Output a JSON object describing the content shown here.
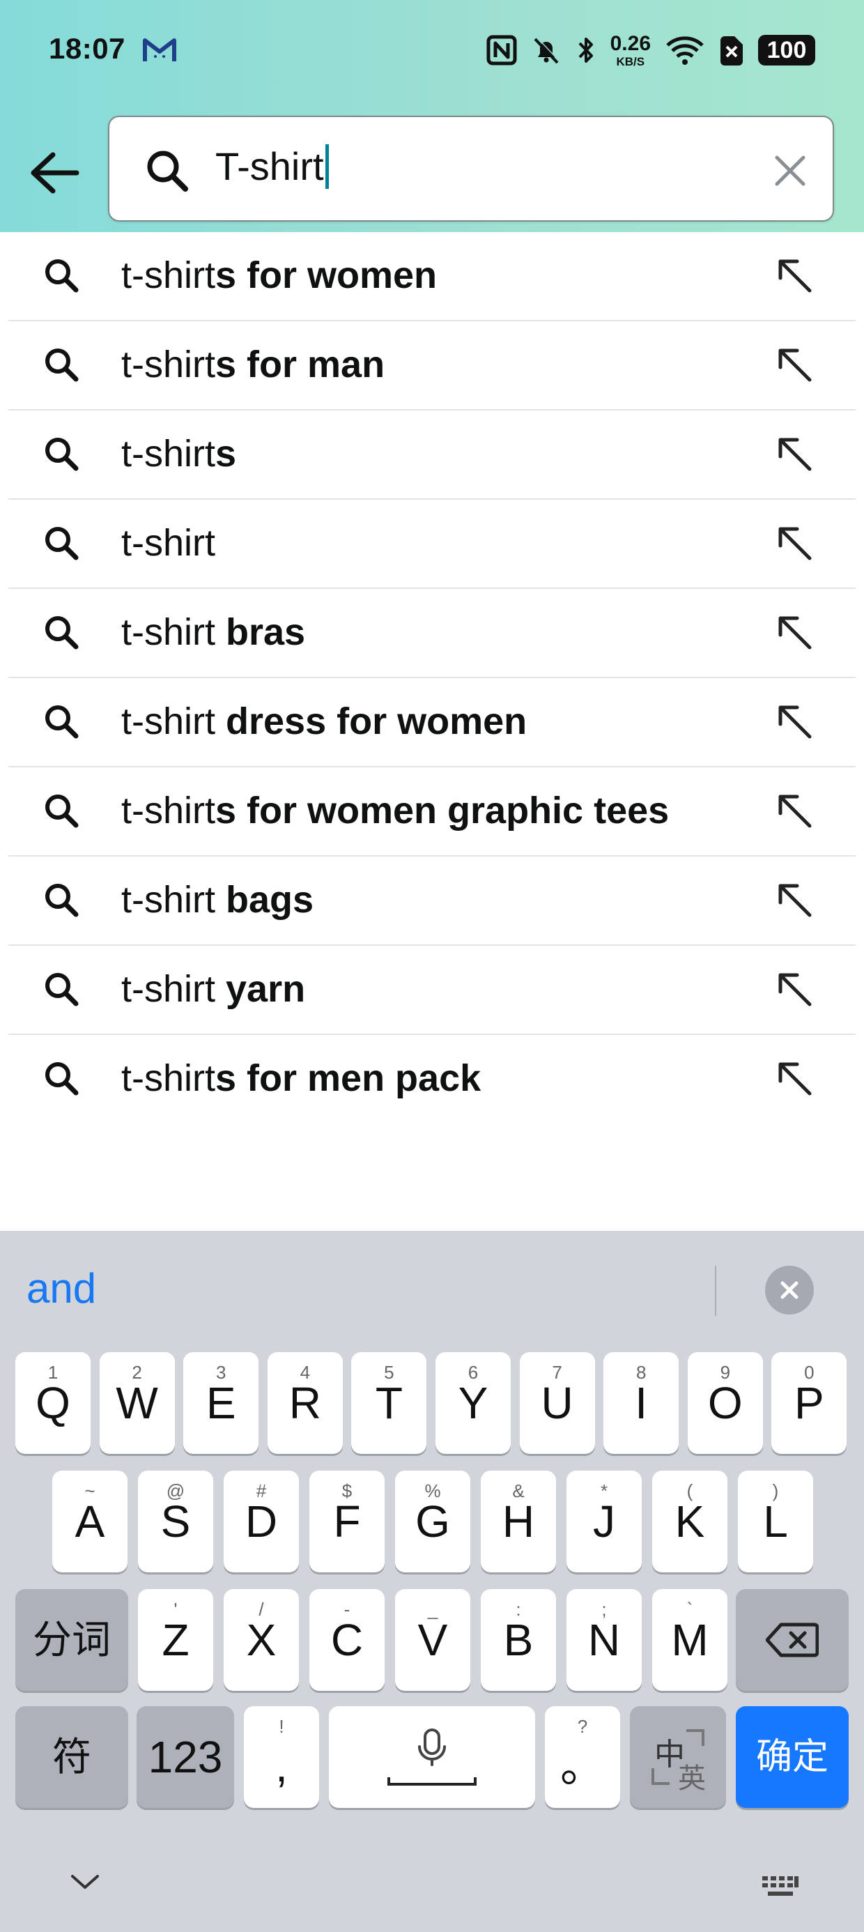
{
  "status_bar": {
    "time": "18:07",
    "network_speed_value": "0.26",
    "network_speed_unit": "KB/S",
    "battery": "100",
    "icons": [
      "gmail-icon",
      "nfc-icon",
      "bell-muted-icon",
      "bluetooth-icon",
      "wifi-icon",
      "sim-off-icon"
    ]
  },
  "search": {
    "query": "T-shirt",
    "icon": "search-icon",
    "clear_icon": "close-icon",
    "back_icon": "back-arrow-icon"
  },
  "suggestions": [
    {
      "prefix": "t-shirt",
      "bold": "s for women"
    },
    {
      "prefix": "t-shirt",
      "bold": "s for man"
    },
    {
      "prefix": "t-shirt",
      "bold": "s"
    },
    {
      "prefix": "t-shirt",
      "bold": ""
    },
    {
      "prefix": "t-shirt ",
      "bold": "bras"
    },
    {
      "prefix": "t-shirt ",
      "bold": "dress for women"
    },
    {
      "prefix": "t-shirt",
      "bold": "s for women graphic tees"
    },
    {
      "prefix": "t-shirt ",
      "bold": "bags"
    },
    {
      "prefix": "t-shirt ",
      "bold": "yarn"
    },
    {
      "prefix": "t-shirt",
      "bold": "s for men pack"
    }
  ],
  "keyboard": {
    "candidate": "and",
    "row1": [
      {
        "main": "Q",
        "sub": "1"
      },
      {
        "main": "W",
        "sub": "2"
      },
      {
        "main": "E",
        "sub": "3"
      },
      {
        "main": "R",
        "sub": "4"
      },
      {
        "main": "T",
        "sub": "5"
      },
      {
        "main": "Y",
        "sub": "6"
      },
      {
        "main": "U",
        "sub": "7"
      },
      {
        "main": "I",
        "sub": "8"
      },
      {
        "main": "O",
        "sub": "9"
      },
      {
        "main": "P",
        "sub": "0"
      }
    ],
    "row2": [
      {
        "main": "A",
        "sub": "~"
      },
      {
        "main": "S",
        "sub": "@"
      },
      {
        "main": "D",
        "sub": "#"
      },
      {
        "main": "F",
        "sub": "$"
      },
      {
        "main": "G",
        "sub": "%"
      },
      {
        "main": "H",
        "sub": "&"
      },
      {
        "main": "J",
        "sub": "*"
      },
      {
        "main": "K",
        "sub": "("
      },
      {
        "main": "L",
        "sub": ")"
      }
    ],
    "row3": [
      {
        "main": "Z",
        "sub": "'"
      },
      {
        "main": "X",
        "sub": "/"
      },
      {
        "main": "C",
        "sub": "-"
      },
      {
        "main": "V",
        "sub": "_"
      },
      {
        "main": "B",
        "sub": ":"
      },
      {
        "main": "N",
        "sub": ";"
      },
      {
        "main": "M",
        "sub": "`"
      }
    ],
    "segment_label": "分词",
    "symbols_label": "符",
    "numbers_label": "123",
    "comma": {
      "main": ",",
      "sub": "!"
    },
    "period": {
      "main": "。",
      "sub": "?"
    },
    "lang_main": "中",
    "lang_sub": "英",
    "confirm_label": "确定",
    "icons": [
      "backspace-icon",
      "microphone-icon",
      "chevron-down-icon",
      "keyboard-icon"
    ]
  },
  "colors": {
    "header_gradient_start": "#85dbd9",
    "header_gradient_end": "#a6e6cf",
    "caret": "#008296",
    "candidate": "#1877f2",
    "confirm_key": "#1677ff",
    "keyboard_bg": "#d1d4db"
  }
}
